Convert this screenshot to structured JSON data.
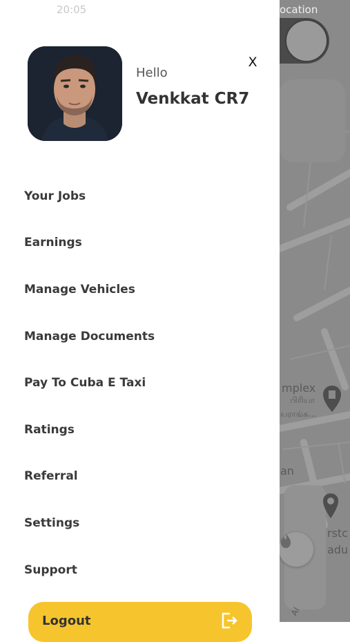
{
  "status_bar": {
    "time": "20:05"
  },
  "map": {
    "top_text": "ocation",
    "place_1": "mplex",
    "place_1_sub": "பிரியா",
    "place_1_sub2": "யராங்க...",
    "place_2": "an",
    "place_3": "rstc",
    "place_3_b": "adu",
    "road_text": "Al"
  },
  "drawer": {
    "greeting": "Hello",
    "user_name": "Venkkat CR7",
    "close_label": "X",
    "menu": [
      "Your Jobs",
      "Earnings",
      "Manage Vehicles",
      "Manage Documents",
      "Pay To Cuba E Taxi",
      "Ratings",
      "Referral",
      "Settings",
      "Support"
    ],
    "logout_label": "Logout"
  },
  "colors": {
    "accent": "#f6c52e",
    "overlay_map": "#8a8a8a",
    "text_dark": "#333333"
  }
}
